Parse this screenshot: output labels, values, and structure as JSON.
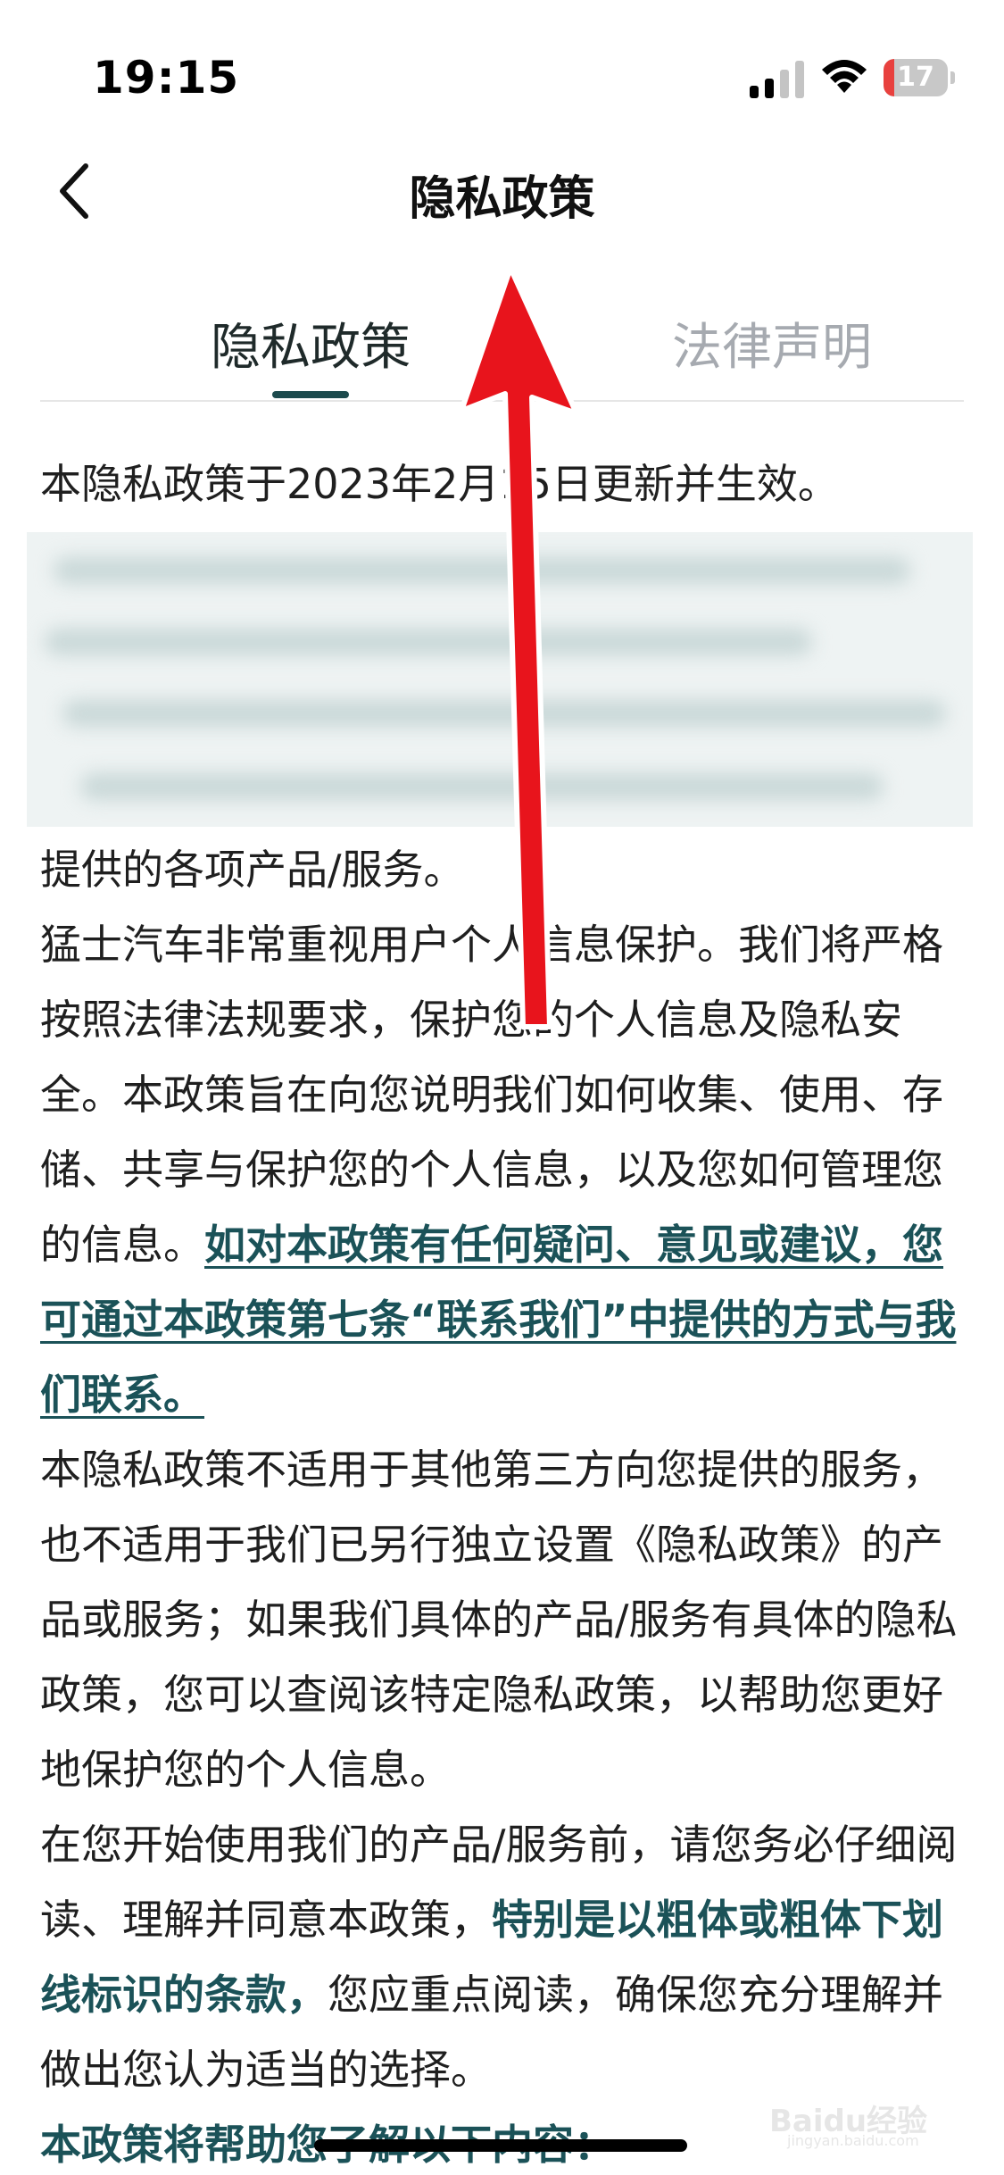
{
  "status_bar": {
    "time": "19:15",
    "battery_level": "17",
    "battery_fraction": 0.17,
    "battery_color": "#e8413e"
  },
  "nav": {
    "title": "隐私政策",
    "back_icon": "chevron-left-icon"
  },
  "tabs": [
    {
      "label": "隐私政策",
      "active": true
    },
    {
      "label": "法律声明",
      "active": false
    }
  ],
  "content": {
    "effective_date_line": "本隐私政策于2023年2月15日更新并生效。",
    "p1": "提供的各项产品/服务。",
    "p2_text": "猛士汽车非常重视用户个人信息保护。我们将严格按照法律法规要求，保护您的个人信息及隐私安全。本政策旨在向您说明我们如何收集、使用、存储、共享与保护您的个人信息，以及您如何管理您的信息。",
    "p2_link": "如对本政策有任何疑问、意见或建议，您可通过本政策第七条“联系我们”中提供的方式与我们联系。",
    "p3": "本隐私政策不适用于其他第三方向您提供的服务，也不适用于我们已另行独立设置《隐私政策》的产品或服务；如果我们具体的产品/服务有具体的隐私政策，您可以查阅该特定隐私政策，以帮助您更好地保护您的个人信息。",
    "p4_text_a": "在您开始使用我们的产品/服务前，请您务必仔细阅读、理解并同意本政策，",
    "p4_bold": "特别是以粗体或粗体下划线标识的条款，",
    "p4_text_b": "您应重点阅读，确保您充分理解并做出您认为适当的选择。",
    "p5_bold": "本政策将帮助您了解以下内容："
  },
  "colors": {
    "accent": "#1b5258",
    "annotation_arrow": "#e8141c"
  },
  "watermark": {
    "text": "Baidu经验",
    "sub": "jingyan.baidu.com"
  }
}
